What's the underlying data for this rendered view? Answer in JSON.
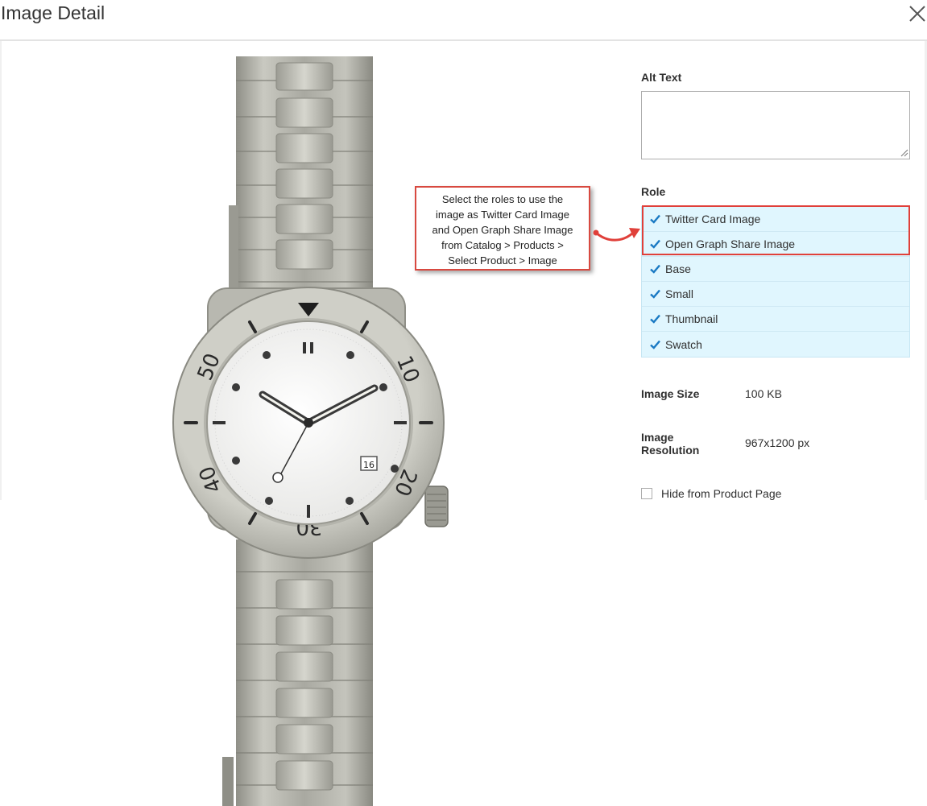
{
  "header": {
    "title": "Image Detail",
    "close_icon": "close-icon"
  },
  "alt_text": {
    "label": "Alt Text",
    "value": ""
  },
  "role": {
    "label": "Role",
    "options": [
      {
        "label": "Twitter Card Image",
        "checked": true
      },
      {
        "label": "Open Graph Share Image",
        "checked": true
      },
      {
        "label": "Base",
        "checked": true
      },
      {
        "label": "Small",
        "checked": true
      },
      {
        "label": "Thumbnail",
        "checked": true
      },
      {
        "label": "Swatch",
        "checked": true
      }
    ]
  },
  "callout": {
    "lines": [
      "Select the roles to use the",
      "image as Twitter Card Image",
      "and Open Graph Share Image",
      "from Catalog > Products >",
      "Select Product > Image"
    ]
  },
  "image_info": {
    "size_label": "Image Size",
    "size_value": "100 KB",
    "resolution_label_line1": "Image",
    "resolution_label_line2": "Resolution",
    "resolution_value": "967x1200 px"
  },
  "hide_from_product_page": {
    "label": "Hide from Product Page",
    "checked": false
  },
  "watch_face": {
    "bezel_numbers": [
      "50",
      "10",
      "40",
      "20",
      "30"
    ],
    "date": "16"
  },
  "colors": {
    "role_background": "#e0f6fe",
    "check_color": "#1979c3",
    "highlight_border": "#e0403a"
  }
}
